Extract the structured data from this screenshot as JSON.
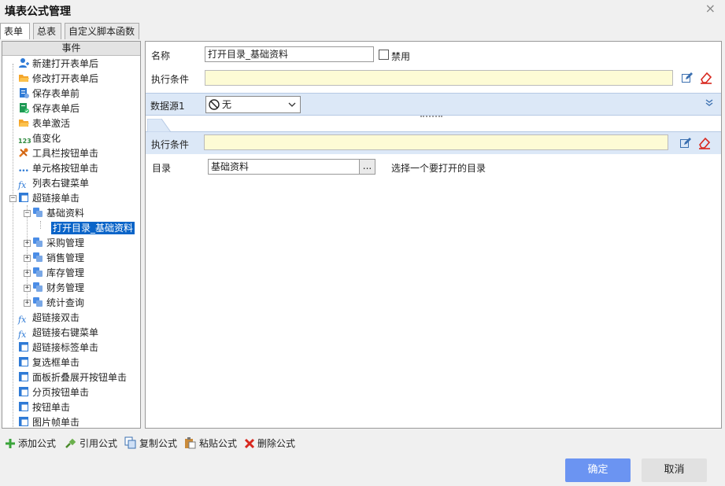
{
  "window": {
    "title": "填表公式管理",
    "close_glyph": "×"
  },
  "tabs": [
    {
      "label": "表单"
    },
    {
      "label": "总表"
    },
    {
      "label": "自定义脚本函数"
    }
  ],
  "events_header": "事件",
  "tree": {
    "items": [
      {
        "label": "新建打开表单后",
        "icon": "user-add-icon"
      },
      {
        "label": "修改打开表单后",
        "icon": "folder-open-icon"
      },
      {
        "label": "保存表单前",
        "icon": "doc-gear-icon"
      },
      {
        "label": "保存表单后",
        "icon": "doc-check-icon"
      },
      {
        "label": "表单激活",
        "icon": "folder-open-icon"
      },
      {
        "label": "值变化",
        "icon": "number-icon",
        "icon_text": "123"
      },
      {
        "label": "工具栏按钮单击",
        "icon": "tools-icon"
      },
      {
        "label": "单元格按钮单击",
        "icon": "dots-icon",
        "icon_text": "•••"
      },
      {
        "label": "列表右键菜单",
        "icon": "fx-icon",
        "icon_text": "fx"
      },
      {
        "label": "超链接单击",
        "icon": "window-icon"
      },
      {
        "label": "基础资料",
        "icon": "link-cube-icon"
      },
      {
        "label": "打开目录_基础资料",
        "selected": true
      },
      {
        "label": "采购管理",
        "icon": "link-cube-icon"
      },
      {
        "label": "销售管理",
        "icon": "link-cube-icon"
      },
      {
        "label": "库存管理",
        "icon": "link-cube-icon"
      },
      {
        "label": "财务管理",
        "icon": "link-cube-icon"
      },
      {
        "label": "统计查询",
        "icon": "link-cube-icon"
      },
      {
        "label": "超链接双击",
        "icon": "fx-icon",
        "icon_text": "fx"
      },
      {
        "label": "超链接右键菜单",
        "icon": "fx-icon",
        "icon_text": "fx"
      },
      {
        "label": "超链接标签单击",
        "icon": "window-icon"
      },
      {
        "label": "复选框单击",
        "icon": "window-icon"
      },
      {
        "label": "面板折叠展开按钮单击",
        "icon": "window-icon"
      },
      {
        "label": "分页按钮单击",
        "icon": "window-icon"
      },
      {
        "label": "按钮单击",
        "icon": "window-icon"
      },
      {
        "label": "图片帧单击",
        "icon": "window-icon"
      }
    ]
  },
  "form": {
    "name_label": "名称",
    "name_value": "打开目录_基础资料",
    "disable_label": "禁用",
    "disable_checked": false,
    "condition_label": "执行条件",
    "condition_value": "",
    "datasource_label": "数据源1",
    "datasource_value": "无",
    "action_condition_label": "执行条件",
    "action_condition_value": "",
    "catalog_label": "目录",
    "catalog_value": "基础资料",
    "catalog_button": "...",
    "catalog_hint": "选择一个要打开的目录"
  },
  "toolbar": {
    "add": "添加公式",
    "ref": "引用公式",
    "copy": "复制公式",
    "paste": "粘贴公式",
    "delete": "删除公式"
  },
  "buttons": {
    "ok": "确定",
    "cancel": "取消"
  },
  "colors": {
    "accent": "#6b94f2",
    "selection": "#0a64c8",
    "condition_bg": "#fdfbd5",
    "datasource_bar": "#dce8f7",
    "delete_red": "#d8281f",
    "add_green": "#3aa43a"
  }
}
